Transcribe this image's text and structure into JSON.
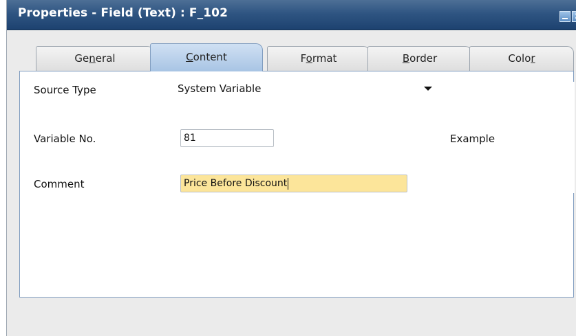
{
  "window": {
    "title": "Properties - Field (Text) : F_102",
    "title_bar_color": "#2f5582"
  },
  "tabs": [
    {
      "label": "General",
      "mnemonic": "n",
      "active": false
    },
    {
      "label": "Content",
      "mnemonic": "C",
      "active": true
    },
    {
      "label": "Format",
      "mnemonic": "o",
      "active": false
    },
    {
      "label": "Border",
      "mnemonic": "B",
      "active": false
    },
    {
      "label": "Color",
      "mnemonic": "r",
      "active": false
    }
  ],
  "form": {
    "source_type_label": "Source Type",
    "source_type_value": "System Variable",
    "variable_no_label": "Variable No.",
    "variable_no_value": "81",
    "comment_label": "Comment",
    "comment_value": "Price Before Discount",
    "comment_field_color": "#fce59a"
  },
  "preview": {
    "example_text": "Example"
  },
  "icons": {
    "minimize": "minimize-icon",
    "close": "close-icon",
    "dropdown": "dropdown-arrow-icon"
  }
}
